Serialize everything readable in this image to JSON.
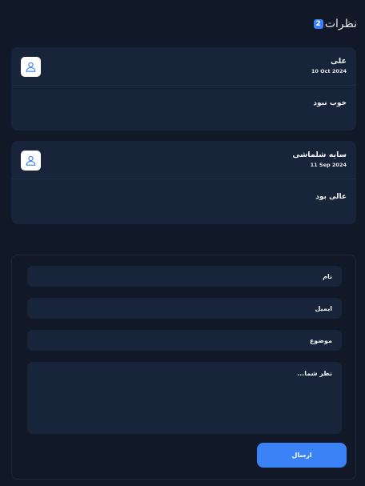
{
  "header": {
    "title": "نظرات",
    "count": "2"
  },
  "comments": [
    {
      "name": "علی",
      "date": "10 Oct 2024",
      "text": "خوب نبود",
      "avatar_icon": "user-icon"
    },
    {
      "name": "سایه شلماشی",
      "date": "11 Sep 2024",
      "text": "عالی بود",
      "avatar_icon": "user-icon"
    }
  ],
  "form": {
    "name_placeholder": "نام",
    "email_placeholder": "ایمیل",
    "subject_placeholder": "موضوع",
    "message_placeholder": "نظر شما...",
    "submit_label": "ارسال"
  },
  "colors": {
    "background": "#111827",
    "card": "#17243a",
    "accent": "#3b82f6",
    "avatar_icon": "#3b82f6"
  }
}
